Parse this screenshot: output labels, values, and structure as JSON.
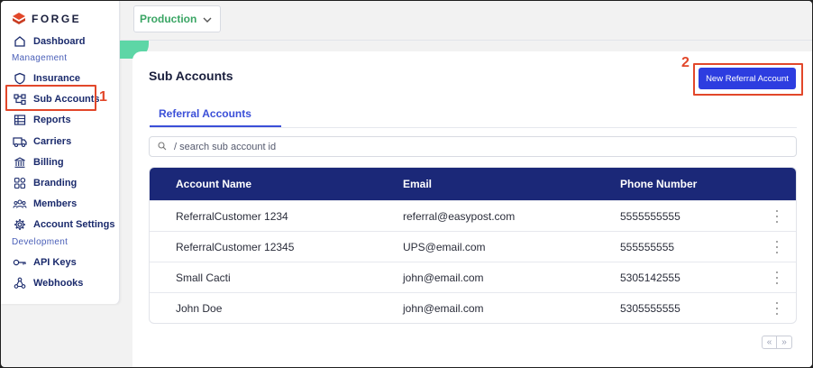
{
  "brand": {
    "name": "FORGE"
  },
  "sidebar": {
    "items": [
      {
        "label": "Dashboard",
        "icon": "home-icon"
      },
      {
        "label": "Insurance",
        "icon": "shield-icon"
      },
      {
        "label": "Sub Accounts",
        "icon": "hierarchy-icon"
      },
      {
        "label": "Reports",
        "icon": "table-icon"
      },
      {
        "label": "Carriers",
        "icon": "truck-icon"
      },
      {
        "label": "Billing",
        "icon": "bank-icon"
      },
      {
        "label": "Branding",
        "icon": "palette-icon"
      },
      {
        "label": "Members",
        "icon": "people-icon"
      },
      {
        "label": "Account Settings",
        "icon": "gear-icon"
      },
      {
        "label": "API Keys",
        "icon": "key-icon"
      },
      {
        "label": "Webhooks",
        "icon": "webhook-icon"
      }
    ],
    "sections": {
      "management": "Management",
      "development": "Development"
    }
  },
  "topbar": {
    "environment": "Production"
  },
  "page": {
    "title": "Sub Accounts",
    "new_button": "New Referral Account",
    "tab": "Referral Accounts",
    "search_placeholder": "/ search sub account id"
  },
  "table": {
    "headers": [
      "Account Name",
      "Email",
      "Phone Number"
    ],
    "rows": [
      {
        "name": "ReferralCustomer 1234",
        "email": "referral@easypost.com",
        "phone": "5555555555"
      },
      {
        "name": "ReferralCustomer 12345",
        "email": "UPS@email.com",
        "phone": "555555555"
      },
      {
        "name": "Small Cacti",
        "email": "john@email.com",
        "phone": "5305142555"
      },
      {
        "name": "John Doe",
        "email": "john@email.com",
        "phone": "5305555555"
      }
    ]
  },
  "pager": {
    "prev": "«",
    "next": "»"
  },
  "annotations": {
    "first": "1",
    "second": "2"
  },
  "colors": {
    "navy": "#1b2878",
    "primary": "#2d3de0",
    "accent_green": "#3aa564",
    "annotation_red": "#e2472a"
  }
}
